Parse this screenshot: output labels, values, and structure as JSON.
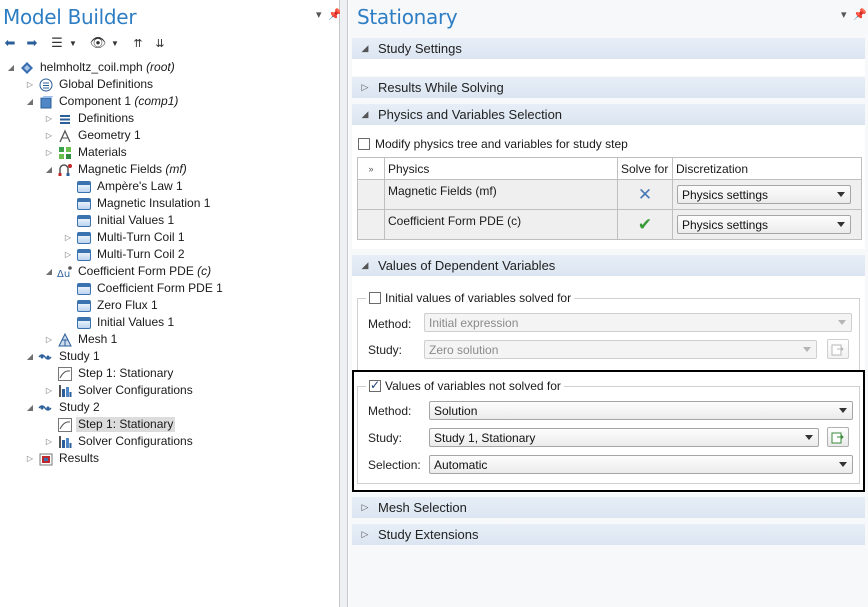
{
  "left": {
    "title": "Model Builder",
    "tree": [
      {
        "label": "helmholtz_coil.mph",
        "tag": "(root)"
      },
      {
        "label": "Global Definitions",
        "tag": ""
      },
      {
        "label": "Component 1",
        "tag": "(comp1)"
      },
      {
        "label": "Definitions",
        "tag": ""
      },
      {
        "label": "Geometry 1",
        "tag": ""
      },
      {
        "label": "Materials",
        "tag": ""
      },
      {
        "label": "Magnetic Fields",
        "tag": "(mf)"
      },
      {
        "label": "Ampère's Law 1",
        "tag": ""
      },
      {
        "label": "Magnetic Insulation 1",
        "tag": ""
      },
      {
        "label": "Initial Values 1",
        "tag": ""
      },
      {
        "label": "Multi-Turn Coil 1",
        "tag": ""
      },
      {
        "label": "Multi-Turn Coil 2",
        "tag": ""
      },
      {
        "label": "Coefficient Form PDE",
        "tag": "(c)"
      },
      {
        "label": "Coefficient Form PDE 1",
        "tag": ""
      },
      {
        "label": "Zero Flux 1",
        "tag": ""
      },
      {
        "label": "Initial Values 1",
        "tag": ""
      },
      {
        "label": "Mesh 1",
        "tag": ""
      },
      {
        "label": "Study 1",
        "tag": ""
      },
      {
        "label": "Step 1: Stationary",
        "tag": ""
      },
      {
        "label": "Solver Configurations",
        "tag": ""
      },
      {
        "label": "Study 2",
        "tag": ""
      },
      {
        "label": "Step 1: Stationary",
        "tag": ""
      },
      {
        "label": "Solver Configurations",
        "tag": ""
      },
      {
        "label": "Results",
        "tag": ""
      }
    ]
  },
  "right": {
    "title": "Stationary",
    "sections": {
      "study_settings": "Study Settings",
      "results_while_solving": "Results While Solving",
      "physics_selection": "Physics and Variables Selection",
      "dependent_vars": "Values of Dependent Variables",
      "mesh_selection": "Mesh Selection",
      "study_extensions": "Study Extensions"
    },
    "modify_label": "Modify physics tree and variables for study step",
    "grid": {
      "headers": [
        "Physics",
        "Solve for",
        "Discretization"
      ],
      "rows": [
        {
          "physics": "Magnetic Fields (mf)",
          "discretization": "Physics settings"
        },
        {
          "physics": "Coefficient Form PDE (c)",
          "discretization": "Physics settings"
        }
      ]
    },
    "initial_group": {
      "title": "Initial values of variables solved for",
      "method_label": "Method:",
      "method_value": "Initial expression",
      "study_label": "Study:",
      "study_value": "Zero solution"
    },
    "notsolved_group": {
      "title": "Values of variables not solved for",
      "method_label": "Method:",
      "method_value": "Solution",
      "study_label": "Study:",
      "study_value": "Study 1, Stationary",
      "selection_label": "Selection:",
      "selection_value": "Automatic"
    }
  },
  "colors": {
    "title_blue": "#2e7ec4",
    "section_bg": "#dbe5f1",
    "highlight_border": "#000000"
  }
}
